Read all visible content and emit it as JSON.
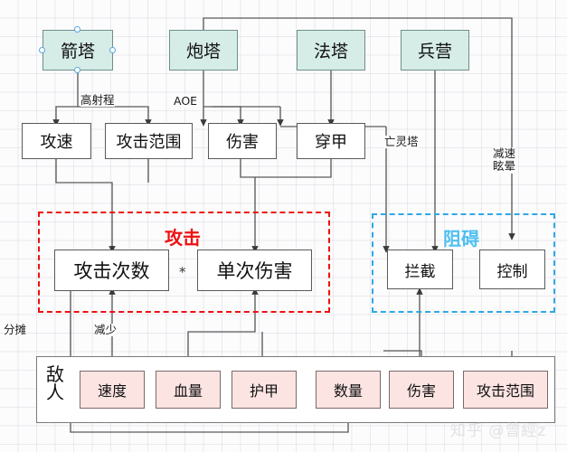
{
  "diagram": {
    "title_watermark": "知乎 @曾經z",
    "towers": [
      {
        "id": "arrow_tower",
        "label": "箭塔",
        "selected": true
      },
      {
        "id": "cannon_tower",
        "label": "炮塔",
        "selected": false
      },
      {
        "id": "magic_tower",
        "label": "法塔",
        "selected": false
      },
      {
        "id": "barracks",
        "label": "兵营",
        "selected": false
      }
    ],
    "attributes": [
      {
        "id": "atk_speed",
        "label": "攻速"
      },
      {
        "id": "atk_range",
        "label": "攻击范围"
      },
      {
        "id": "damage",
        "label": "伤害"
      },
      {
        "id": "armor_pierce",
        "label": "穿甲"
      }
    ],
    "attack_group": {
      "label": "攻击",
      "color": "#ee1111",
      "nodes": [
        {
          "id": "hit_count",
          "label": "攻击次数"
        },
        {
          "id": "single_damage",
          "label": "单次伤害"
        }
      ],
      "operator": "*"
    },
    "block_group": {
      "label": "阻碍",
      "color": "#4fc0f0",
      "nodes": [
        {
          "id": "intercept",
          "label": "拦截"
        },
        {
          "id": "control",
          "label": "控制"
        }
      ]
    },
    "enemy": {
      "label": "敌人",
      "items": [
        {
          "id": "speed",
          "label": "速度"
        },
        {
          "id": "hp",
          "label": "血量"
        },
        {
          "id": "armor",
          "label": "护甲"
        },
        {
          "id": "count",
          "label": "数量"
        },
        {
          "id": "e_damage",
          "label": "伤害"
        },
        {
          "id": "e_range",
          "label": "攻击范围"
        }
      ]
    },
    "edge_labels": [
      {
        "id": "high_range",
        "text": "高射程"
      },
      {
        "id": "aoe",
        "text": "AOE"
      },
      {
        "id": "undead_tower",
        "text": "亡灵塔"
      },
      {
        "id": "slow_stun",
        "text": "减速\n眩晕"
      },
      {
        "id": "slow_stun_1",
        "text": "减速"
      },
      {
        "id": "slow_stun_2",
        "text": "眩晕"
      },
      {
        "id": "share",
        "text": "分摊"
      },
      {
        "id": "reduce",
        "text": "减少"
      }
    ]
  }
}
